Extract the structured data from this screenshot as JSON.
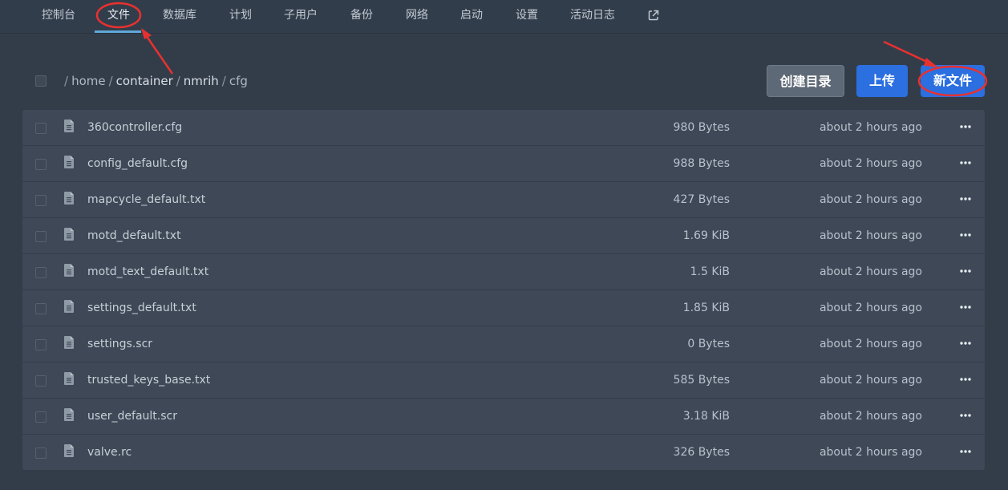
{
  "nav": {
    "items": [
      {
        "label": "控制台"
      },
      {
        "label": "文件"
      },
      {
        "label": "数据库"
      },
      {
        "label": "计划"
      },
      {
        "label": "子用户"
      },
      {
        "label": "备份"
      },
      {
        "label": "网络"
      },
      {
        "label": "启动"
      },
      {
        "label": "设置"
      },
      {
        "label": "活动日志"
      }
    ],
    "active": "文件",
    "external_icon": "external-link-icon"
  },
  "breadcrumb": {
    "segments": [
      "home",
      "container",
      "nmrih",
      "cfg"
    ]
  },
  "actions": {
    "create_dir_label": "创建目录",
    "upload_label": "上传",
    "new_file_label": "新文件"
  },
  "files": [
    {
      "name": "360controller.cfg",
      "size": "980 Bytes",
      "modified": "about 2 hours ago"
    },
    {
      "name": "config_default.cfg",
      "size": "988 Bytes",
      "modified": "about 2 hours ago"
    },
    {
      "name": "mapcycle_default.txt",
      "size": "427 Bytes",
      "modified": "about 2 hours ago"
    },
    {
      "name": "motd_default.txt",
      "size": "1.69 KiB",
      "modified": "about 2 hours ago"
    },
    {
      "name": "motd_text_default.txt",
      "size": "1.5 KiB",
      "modified": "about 2 hours ago"
    },
    {
      "name": "settings_default.txt",
      "size": "1.85 KiB",
      "modified": "about 2 hours ago"
    },
    {
      "name": "settings.scr",
      "size": "0 Bytes",
      "modified": "about 2 hours ago"
    },
    {
      "name": "trusted_keys_base.txt",
      "size": "585 Bytes",
      "modified": "about 2 hours ago"
    },
    {
      "name": "user_default.scr",
      "size": "3.18 KiB",
      "modified": "about 2 hours ago"
    },
    {
      "name": "valve.rc",
      "size": "326 Bytes",
      "modified": "about 2 hours ago"
    }
  ],
  "colors": {
    "background": "#333d4a",
    "row": "#3e4856",
    "accent_blue": "#2b6fe0",
    "annotation_red": "#e8312f"
  }
}
